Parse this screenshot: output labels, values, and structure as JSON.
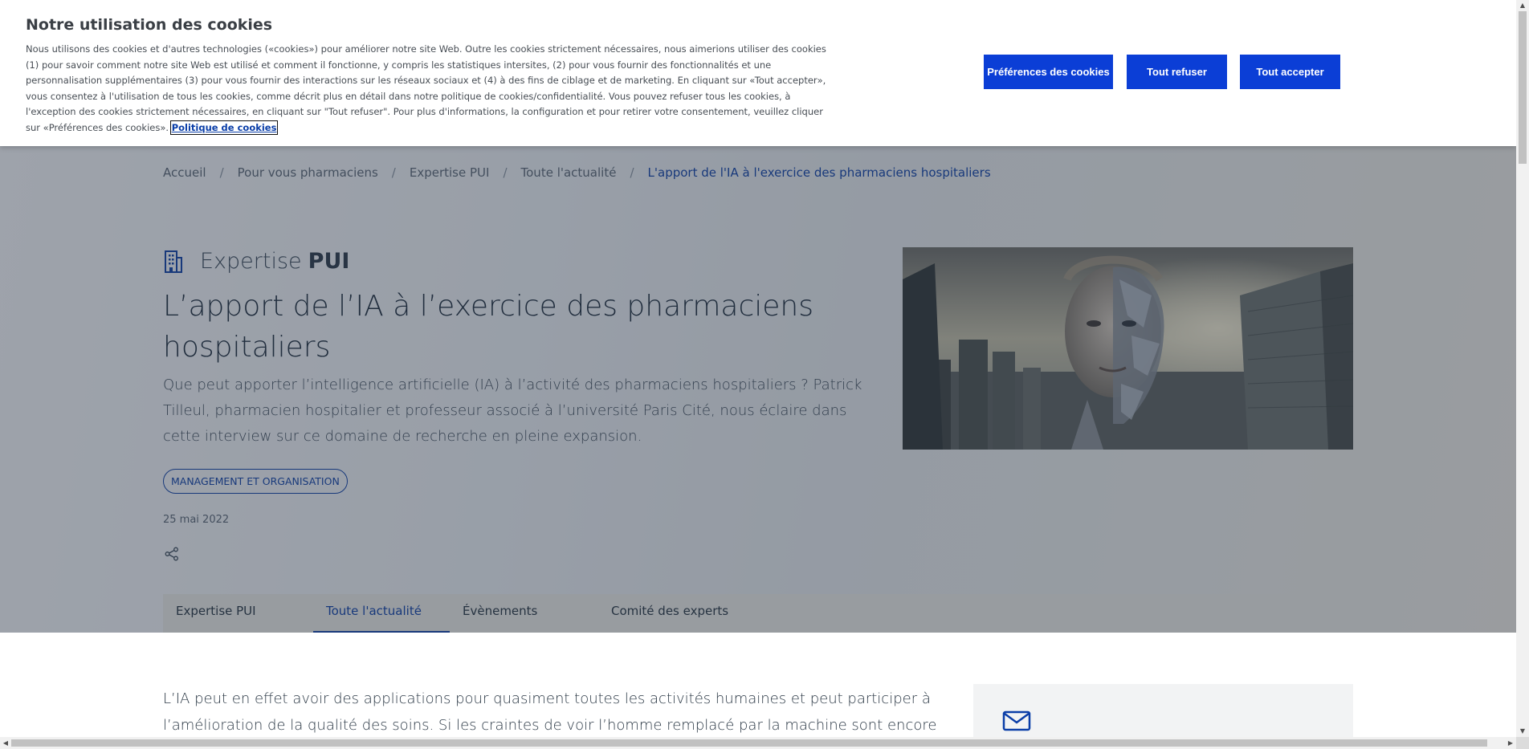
{
  "cookie_banner": {
    "title": "Notre utilisation des cookies",
    "text": "Nous utilisons des cookies et d'autres technologies («cookies») pour améliorer notre site Web. Outre les cookies strictement nécessaires, nous aimerions utiliser des cookies (1) pour savoir comment notre site Web est utilisé et comment il fonctionne, y compris les statistiques intersites, (2) pour vous fournir des fonctionnalités et une personnalisation supplémentaires (3) pour vous fournir des interactions sur les réseaux sociaux et (4) à des fins de ciblage et de marketing. En cliquant sur «Tout accepter», vous consentez à l'utilisation de tous les cookies, comme décrit plus en détail dans notre politique de cookies/confidentialité. Vous pouvez refuser tous les cookies, à l'exception des cookies strictement nécessaires, en cliquant sur \"Tout refuser\". Pour plus d'informations, la configuration et pour retirer votre consentement, veuillez cliquer sur «Préférences des cookies».",
    "policy_link": "Politique de cookies",
    "buttons": {
      "preferences": "Préférences des cookies",
      "reject": "Tout refuser",
      "accept": "Tout accepter"
    }
  },
  "breadcrumb": {
    "separator": "/",
    "items": [
      "Accueil",
      "Pour vous pharmaciens",
      "Expertise PUI",
      "Toute l'actualité"
    ],
    "current": "L'apport de l'IA à l'exercice des pharmaciens hospitaliers"
  },
  "article": {
    "kicker_light": "Expertise",
    "kicker_bold": "PUI",
    "title": "L’apport de l’IA à l’exercice des pharmaciens hospitaliers",
    "lead": "Que peut apporter l’intelligence artificielle (IA) à l’activité des pharmaciens hospitaliers ? Patrick Tilleul, pharmacien hospitalier et professeur associé à l’université Paris Cité, nous éclaire dans cette interview sur ce domaine de recherche en pleine expansion.",
    "tag": "MANAGEMENT ET ORGANISATION",
    "date": "25 mai 2022",
    "share_icon": "share-icon",
    "image_icon": "ai-humanoid-city-image"
  },
  "tabs": [
    {
      "label": "Expertise PUI",
      "active": false
    },
    {
      "label": "Toute l'actualité",
      "active": true
    },
    {
      "label": "Évènements",
      "active": false
    },
    {
      "label": "Comité des experts",
      "active": false
    }
  ],
  "body": {
    "paragraph": "L’IA peut en effet avoir des applications pour quasiment toutes les activités humaines et peut participer à l’amélioration de la qualité des soins. Si les craintes de voir l’homme remplacé par la machine sont encore parfois évoquées, à terme,"
  },
  "sidebar": {
    "icon": "mail-icon"
  },
  "colors": {
    "brand_blue": "#0b3ed6",
    "link_blue": "#0b3ea8",
    "overlay": "rgba(40,52,68,0.45)"
  }
}
